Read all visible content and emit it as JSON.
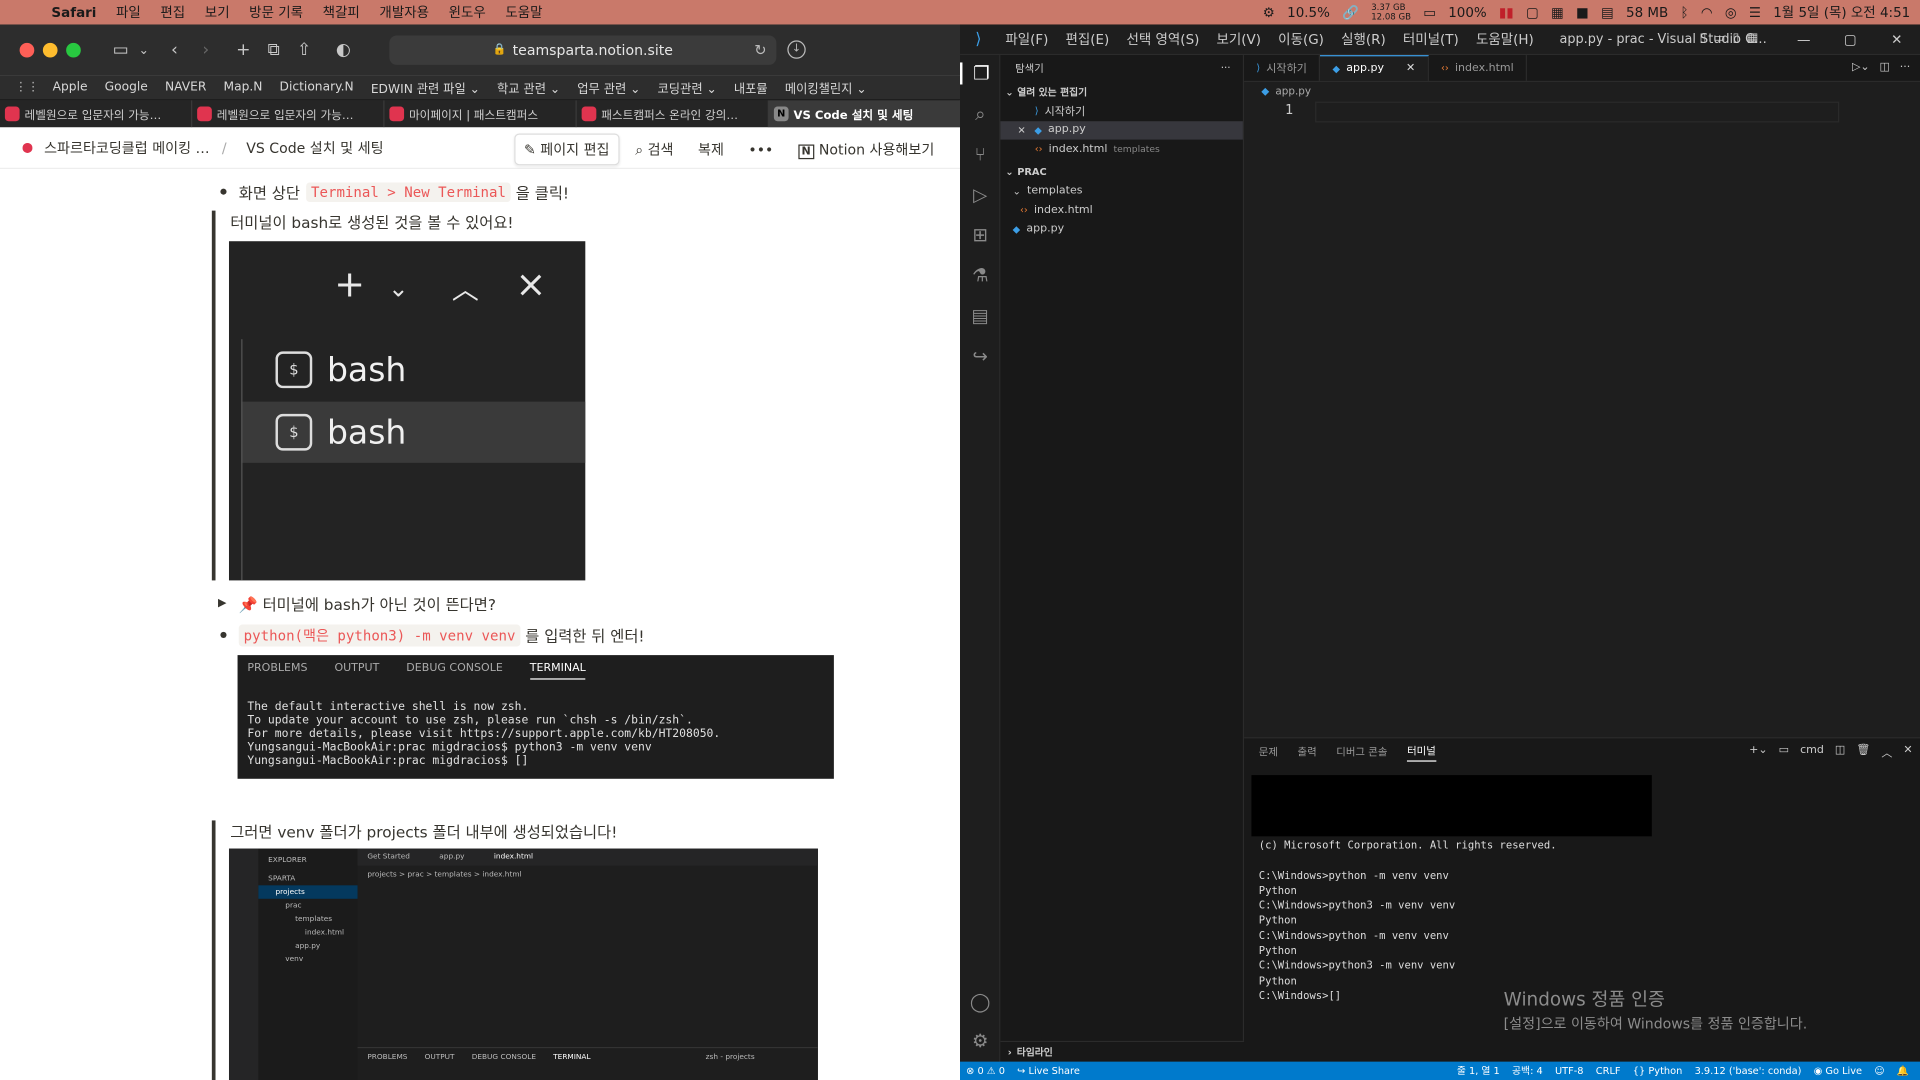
{
  "menubar": {
    "app": "Safari",
    "items": [
      "파일",
      "편집",
      "보기",
      "방문 기록",
      "책갈피",
      "개발자용",
      "윈도우",
      "도움말"
    ],
    "right": {
      "cpu": "10.5%",
      "mem_top": "3.37 GB",
      "mem_bottom": "12.08 GB",
      "battery": "100%",
      "net": "58 MB",
      "datetime": "1월 5일 (목) 오전 4:51"
    }
  },
  "safari": {
    "url": "teamsparta.notion.site",
    "bookmarks": [
      "Apple",
      "Google",
      "NAVER",
      "Map.N",
      "Dictionary.N",
      "EDWIN 관련 파일 ⌄",
      "학교 관련 ⌄",
      "업무 관련 ⌄",
      "코딩관련 ⌄",
      "내포뮬",
      "메이킹챌린지 ⌄"
    ],
    "tabs": [
      "레벨원으로 입문자의 가능…",
      "레벨원으로 입문자의 가능…",
      "마이페이지 | 패스트캠퍼스",
      "패스트캠퍼스 온라인 강의…",
      "VS Code 설치 및 세팅"
    ],
    "notion": {
      "crumb1": "스파르타코딩클럽 메이킹 …",
      "crumb_sep": "/",
      "crumb2": "VS Code 설치 및 세팅",
      "edit": "페이지 편집",
      "search": "검색",
      "duplicate": "복제",
      "more": "•••",
      "try": "Notion 사용해보기"
    }
  },
  "content": {
    "b1_pre": "화면 상단",
    "b1_code": "Terminal > New Terminal",
    "b1_post": "을 클릭!",
    "q1": "터미널이 bash로 생성된 것을 볼 수 있어요!",
    "bash1": "bash",
    "bash2": "bash",
    "toggle": "📌 터미널에 bash가 아닌 것이 뜬다면?",
    "b2_code": "python(맥은 python3) -m venv venv",
    "b2_post": "를 입력한 뒤 엔터!",
    "term_tabs": [
      "PROBLEMS",
      "OUTPUT",
      "DEBUG CONSOLE",
      "TERMINAL"
    ],
    "term_lines": [
      "The default interactive shell is now zsh.",
      "To update your account to use zsh, please run `chsh -s /bin/zsh`.",
      "For more details, please visit https://support.apple.com/kb/HT208050.",
      "Yungsangui-MacBookAir:prac migdracios$ python3 -m venv venv",
      "Yungsangui-MacBookAir:prac migdracios$ []"
    ],
    "q2": "그러면 venv 폴더가 projects 폴더 내부에 생성되었습니다!",
    "mini": {
      "explorer": "EXPLORER",
      "sparta": "SPARTA",
      "tab1": "Get Started",
      "tab2": "app.py",
      "tab3": "index.html",
      "crumb": "projects > prac > templates > index.html",
      "tree": [
        "projects",
        "prac",
        "templates",
        "index.html",
        "app.py",
        "venv"
      ],
      "ptabs": [
        "PROBLEMS",
        "OUTPUT",
        "DEBUG CONSOLE",
        "TERMINAL"
      ],
      "zsh": "zsh - projects"
    }
  },
  "vscode": {
    "menu": [
      "파일(F)",
      "편집(E)",
      "선택 영역(S)",
      "보기(V)",
      "이동(G)",
      "실행(R)",
      "터미널(T)",
      "도움말(H)"
    ],
    "title": "app.py - prac - Visual Studio C…",
    "explorer": "탐색기",
    "open_editors": "열려 있는 편집기",
    "open1": "시작하기",
    "open2": "app.py",
    "open3": "index.html",
    "open3_dim": "templates",
    "prac": "PRAC",
    "tree_templates": "templates",
    "tree_index": "index.html",
    "tree_app": "app.py",
    "tabs": [
      "시작하기",
      "app.py",
      "index.html"
    ],
    "breadcrumb": "app.py",
    "line1": "1",
    "panel_tabs": [
      "문제",
      "출력",
      "디버그 콘솔",
      "터미널"
    ],
    "shell": "cmd",
    "term": [
      "(c) Microsoft Corporation. All rights reserved.",
      "",
      "C:\\Windows>python -m venv venv",
      "Python",
      "C:\\Windows>python3 -m venv venv",
      "Python",
      "C:\\Windows>python -m venv venv",
      "Python",
      "C:\\Windows>python3 -m venv venv",
      "Python",
      "C:\\Windows>[]"
    ],
    "watermark1": "Windows 정품 인증",
    "watermark2": "[설정]으로 이동하여 Windows를 정품 인증합니다.",
    "timeline": "타임라인",
    "status_left": [
      "⊗ 0 ⚠ 0",
      "Live Share"
    ],
    "status_right": [
      "줄 1, 열 1",
      "공백: 4",
      "UTF-8",
      "CRLF",
      "Python",
      "3.9.12 ('base': conda)",
      "Go Live"
    ]
  },
  "colors": {
    "menubar": "#c9796a",
    "vs_status": "#007acc",
    "accent": "#3c9ee6",
    "notion_code": "#eb5757"
  }
}
